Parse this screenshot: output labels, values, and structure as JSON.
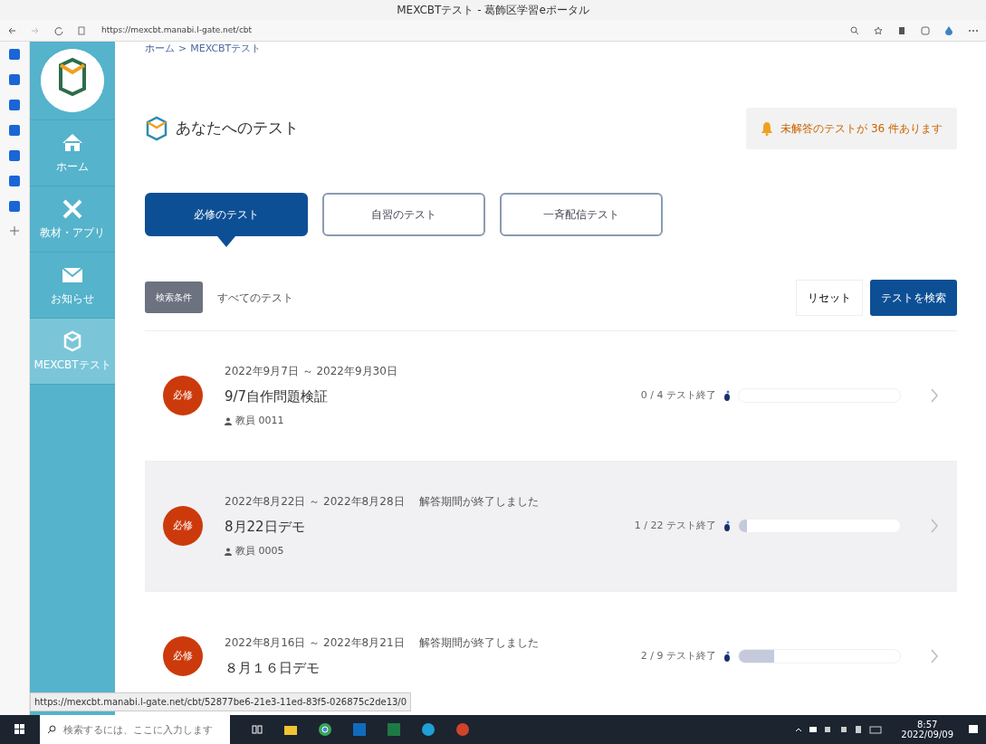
{
  "browser": {
    "title": "MEXCBTテスト - 葛飾区学習eポータル",
    "url": "https://mexcbt.manabi.l-gate.net/cbt"
  },
  "breadcrumb": {
    "items": [
      "ホーム",
      "MEXCBTテスト"
    ],
    "separator": ">"
  },
  "sidebar": {
    "items": [
      {
        "label": "ホーム",
        "selected": false
      },
      {
        "label": "教材・アプリ",
        "selected": false
      },
      {
        "label": "お知らせ",
        "selected": false
      },
      {
        "label": "MEXCBTテスト",
        "selected": true
      }
    ]
  },
  "page_title": "あなたへのテスト",
  "notice": "未解答のテストが 36 件あります",
  "tabs": [
    {
      "label": "必修のテスト",
      "selected": true
    },
    {
      "label": "自習のテスト",
      "selected": false
    },
    {
      "label": "一斉配信テスト",
      "selected": false
    }
  ],
  "filter": {
    "badge": "検索条件",
    "value": "すべてのテスト",
    "reset": "リセット",
    "search": "テストを検索"
  },
  "tests": [
    {
      "badge": "必修",
      "period": "2022年9月7日 ～ 2022年9月30日",
      "title": "9/7自作問題検証",
      "teacher": "教員 0011",
      "progress": "0 / 4 テスト終了",
      "level": 0,
      "highlighted": false
    },
    {
      "badge": "必修",
      "period": "2022年8月22日 ～ 2022年8月28日",
      "status": "解答期間が終了しました",
      "title": "8月22日デモ",
      "teacher": "教員 0005",
      "progress": "1 / 22 テスト終了",
      "level": 0.05,
      "highlighted": true
    },
    {
      "badge": "必修",
      "period": "2022年8月16日 ～ 2022年8月21日",
      "status": "解答期間が終了しました",
      "title": "８月１６日デモ",
      "progress": "2 / 9 テスト終了",
      "level": 0.22,
      "highlighted": false
    }
  ],
  "status_url": "https://mexcbt.manabi.l-gate.net/cbt/52877be6-21e3-11ed-83f5-026875c2de13/0",
  "taskbar": {
    "search_placeholder": "検索するには、ここに入力します",
    "time": "8:57",
    "date": "2022/09/09"
  }
}
